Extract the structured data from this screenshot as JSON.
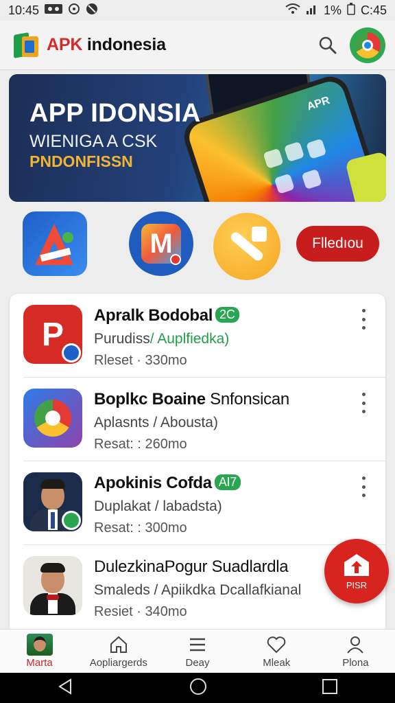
{
  "status_bar": {
    "time": "10:45",
    "battery_text": "1%",
    "right_time": "C:45"
  },
  "app_bar": {
    "title_accent": "APK",
    "title_rest": " indonesia"
  },
  "banner": {
    "title": "APP IDONSIA",
    "subtitle": "WIENIGA A CSK",
    "tagline": "PNDONFISSN",
    "phone_text": "APR"
  },
  "featured": {
    "follow_label": "Flledıou"
  },
  "apps": [
    {
      "title": "Apralk Bodobal",
      "tag": "2C",
      "subtitle_plain": "Purudiss",
      "subtitle_green": "/ Auplfiedka)",
      "meta": "Rleset · 330mo"
    },
    {
      "title_bold": "Boplkc Boaine",
      "title_rest": " Snfonsican",
      "subtitle": "Aplasnts / Abousta)",
      "meta": "Resat: : 260mo"
    },
    {
      "title": "Apokinis Cofda",
      "tag": "AI7",
      "subtitle": "Duplakat / labadsta)",
      "meta": "Resat: : 300mo"
    },
    {
      "title": "DulezkinaPogur Suadlardla",
      "subtitle": "Smaleds / Apiikdka Dcallafkianal",
      "meta": "Resiet · 340mo"
    }
  ],
  "fab": {
    "label": "PISR"
  },
  "bottom_nav": [
    {
      "label": "Marta",
      "icon": "avatar"
    },
    {
      "label": "Aopliargerds",
      "icon": "home-icon"
    },
    {
      "label": "Deay",
      "icon": "menu-icon"
    },
    {
      "label": "Mleak",
      "icon": "heart-icon"
    },
    {
      "label": "Plona",
      "icon": "person-icon"
    }
  ],
  "colors": {
    "accent_red": "#d32b2b",
    "brand_green": "#1f9d4a",
    "banner_highlight": "#f2b533"
  }
}
